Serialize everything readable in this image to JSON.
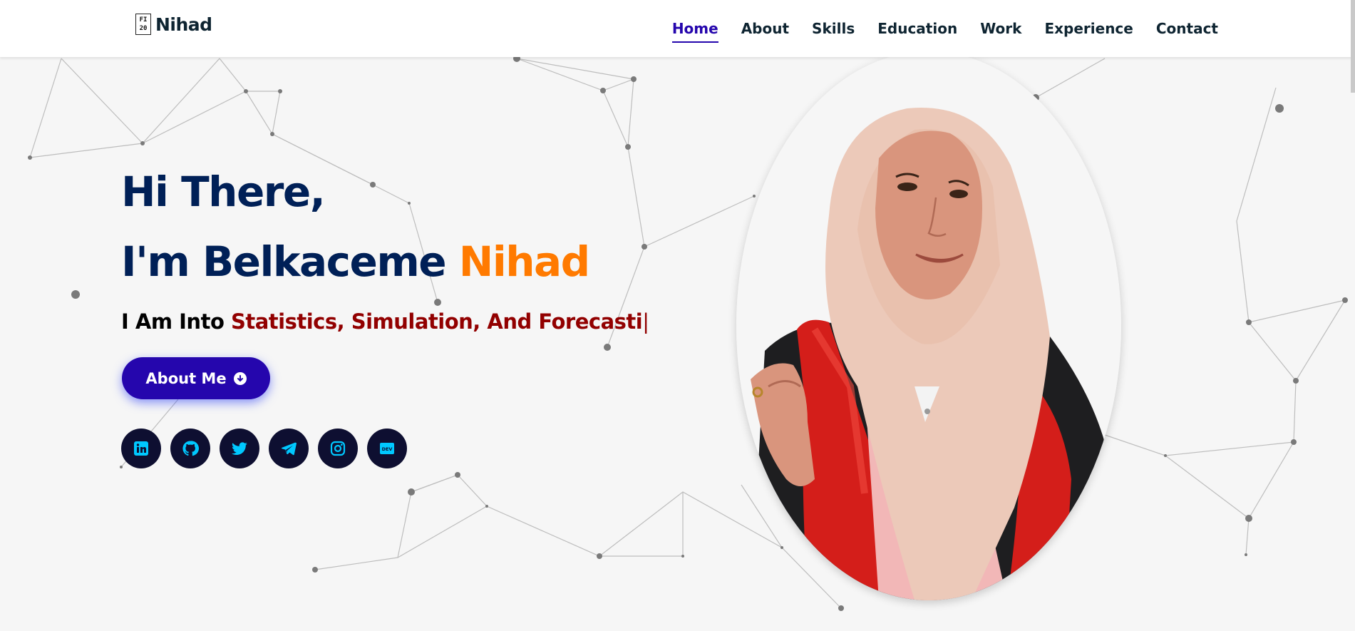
{
  "header": {
    "logo_mark": "FI\n20",
    "logo_text": "Nihad",
    "nav": [
      {
        "label": "Home",
        "active": true
      },
      {
        "label": "About",
        "active": false
      },
      {
        "label": "Skills",
        "active": false
      },
      {
        "label": "Education",
        "active": false
      },
      {
        "label": "Work",
        "active": false
      },
      {
        "label": "Experience",
        "active": false
      },
      {
        "label": "Contact",
        "active": false
      }
    ]
  },
  "hero": {
    "greeting": "Hi There,",
    "intro": "I'm Belkaceme ",
    "name": "Nihad",
    "subtitle_prefix": "I Am Into ",
    "subtitle_typed": "Statistics, Simulation, And Forecasti",
    "cursor": "|",
    "button_label": "About Me",
    "socials": [
      {
        "icon": "linkedin-icon"
      },
      {
        "icon": "github-icon"
      },
      {
        "icon": "twitter-icon"
      },
      {
        "icon": "telegram-icon"
      },
      {
        "icon": "instagram-icon"
      },
      {
        "icon": "dev-icon"
      }
    ]
  },
  "colors": {
    "accent": "#2506ad",
    "title": "#002057",
    "name": "#ff7a00",
    "typed": "#920000",
    "social_bg": "#0e0f31",
    "social_icon": "#00c8ff"
  }
}
